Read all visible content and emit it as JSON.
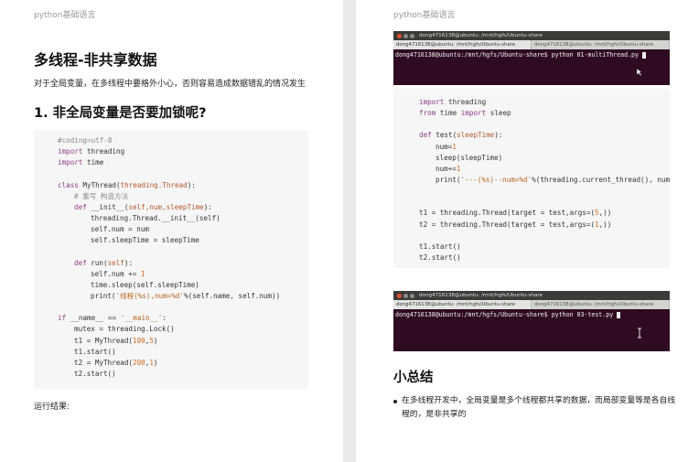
{
  "left_page": {
    "header": "python基础语言",
    "title": "多线程-非共享数据",
    "intro": "对于全局变量，在多线程中要格外小心，否则容易造成数据错乱的情况发生",
    "section_title": "1. 非全局变量是否要加锁呢?",
    "code": [
      {
        "i": 0,
        "s": [
          {
            "t": "#coding=utf-8",
            "c": "cm"
          }
        ]
      },
      {
        "i": 0,
        "s": [
          {
            "t": "import",
            "c": "kw"
          },
          {
            "t": " threading"
          }
        ]
      },
      {
        "i": 0,
        "s": [
          {
            "t": "import",
            "c": "kw"
          },
          {
            "t": " time"
          }
        ]
      },
      {
        "i": 0,
        "s": []
      },
      {
        "i": 0,
        "s": [
          {
            "t": "class",
            "c": "kw"
          },
          {
            "t": " MyThread("
          },
          {
            "t": "threading.Thread",
            "c": "pa"
          },
          {
            "t": "):"
          }
        ]
      },
      {
        "i": 1,
        "s": [
          {
            "t": "# 重写 构造方法",
            "c": "cm"
          }
        ]
      },
      {
        "i": 1,
        "s": [
          {
            "t": "def",
            "c": "kw"
          },
          {
            "t": " __init__("
          },
          {
            "t": "self,num,sleepTime",
            "c": "pa"
          },
          {
            "t": "):"
          }
        ]
      },
      {
        "i": 2,
        "s": [
          {
            "t": "threading.Thread.__init__(self)"
          }
        ]
      },
      {
        "i": 2,
        "s": [
          {
            "t": "self.num = num"
          }
        ]
      },
      {
        "i": 2,
        "s": [
          {
            "t": "self.sleepTime = sleepTime"
          }
        ]
      },
      {
        "i": 0,
        "s": []
      },
      {
        "i": 1,
        "s": [
          {
            "t": "def",
            "c": "kw"
          },
          {
            "t": " run("
          },
          {
            "t": "self",
            "c": "pa"
          },
          {
            "t": "):"
          }
        ]
      },
      {
        "i": 2,
        "s": [
          {
            "t": "self.num += "
          },
          {
            "t": "1",
            "c": "nm"
          }
        ]
      },
      {
        "i": 2,
        "s": [
          {
            "t": "time.sleep(self.sleepTime)"
          }
        ]
      },
      {
        "i": 2,
        "s": [
          {
            "t": "print("
          },
          {
            "t": "'线程(%s),num=%d'",
            "c": "st"
          },
          {
            "t": "%(self.name, self.num))"
          }
        ]
      },
      {
        "i": 0,
        "s": []
      },
      {
        "i": 0,
        "s": [
          {
            "t": "if",
            "c": "kw"
          },
          {
            "t": " __name__ == "
          },
          {
            "t": "'__main__'",
            "c": "st"
          },
          {
            "t": ":"
          }
        ]
      },
      {
        "i": 1,
        "s": [
          {
            "t": "mutex = threading.Lock()"
          }
        ]
      },
      {
        "i": 1,
        "s": [
          {
            "t": "t1 = MyThread("
          },
          {
            "t": "100",
            "c": "nm"
          },
          {
            "t": ","
          },
          {
            "t": "5",
            "c": "nm"
          },
          {
            "t": ")"
          }
        ]
      },
      {
        "i": 1,
        "s": [
          {
            "t": "t1.start()"
          }
        ]
      },
      {
        "i": 1,
        "s": [
          {
            "t": "t2 = MyThread("
          },
          {
            "t": "200",
            "c": "nm"
          },
          {
            "t": ","
          },
          {
            "t": "1",
            "c": "nm"
          },
          {
            "t": ")"
          }
        ]
      },
      {
        "i": 1,
        "s": [
          {
            "t": "t2.start()"
          }
        ]
      }
    ],
    "result_label": "运行结果:"
  },
  "right_page": {
    "header": "python基础语言",
    "terminal_1": {
      "title": "dong4716138@ubuntu: /mnt/hgfs/Ubuntu-share",
      "tabs": [
        "dong4716138@ubuntu: /mnt/hgfs/Ubuntu-share",
        "dong4716138@ubuntu: /mnt/hgfs/Ubuntu-share"
      ],
      "command": "dong4716138@ubuntu:/mnt/hgfs/Ubuntu-share$ python 01-multiThread.py"
    },
    "code": [
      {
        "i": 0,
        "s": [
          {
            "t": "import",
            "c": "kw"
          },
          {
            "t": " threading"
          }
        ]
      },
      {
        "i": 0,
        "s": [
          {
            "t": "from",
            "c": "kw"
          },
          {
            "t": " time "
          },
          {
            "t": "import",
            "c": "kw"
          },
          {
            "t": " sleep"
          }
        ]
      },
      {
        "i": 0,
        "s": []
      },
      {
        "i": 0,
        "s": [
          {
            "t": "def",
            "c": "kw"
          },
          {
            "t": " test("
          },
          {
            "t": "sleepTime",
            "c": "pa"
          },
          {
            "t": "):"
          }
        ]
      },
      {
        "i": 1,
        "s": [
          {
            "t": "num="
          },
          {
            "t": "1",
            "c": "nm"
          }
        ]
      },
      {
        "i": 1,
        "s": [
          {
            "t": "sleep(sleepTime)"
          }
        ]
      },
      {
        "i": 1,
        "s": [
          {
            "t": "num+="
          },
          {
            "t": "1",
            "c": "nm"
          }
        ]
      },
      {
        "i": 1,
        "s": [
          {
            "t": "print("
          },
          {
            "t": "'---(%s)--num=%d'",
            "c": "st"
          },
          {
            "t": "%(threading.current_thread(), num"
          }
        ]
      },
      {
        "i": 0,
        "s": []
      },
      {
        "i": 0,
        "s": []
      },
      {
        "i": 0,
        "s": [
          {
            "t": "t1 = threading.Thread(target = test,args=("
          },
          {
            "t": "5",
            "c": "nm"
          },
          {
            "t": ",))"
          }
        ]
      },
      {
        "i": 0,
        "s": [
          {
            "t": "t2 = threading.Thread(target = test,args=("
          },
          {
            "t": "1",
            "c": "nm"
          },
          {
            "t": ",))"
          }
        ]
      },
      {
        "i": 0,
        "s": []
      },
      {
        "i": 0,
        "s": [
          {
            "t": "t1.start()"
          }
        ]
      },
      {
        "i": 0,
        "s": [
          {
            "t": "t2.start()"
          }
        ]
      }
    ],
    "terminal_2": {
      "title": "dong4716138@ubuntu: /mnt/hgfs/Ubuntu-share",
      "tabs": [
        "dong4716138@ubuntu: /mnt/hgfs/Ubuntu-share",
        "dong4716138@ubuntu: /mnt/hgfs/Ubuntu-share"
      ],
      "command": "dong4716138@ubuntu:/mnt/hgfs/Ubuntu-share$ python 03-test.py"
    },
    "summary_title": "小总结",
    "summary_items": [
      "在多线程开发中，全局变量是多个线程都共享的数据，而局部变量等是各自线程的，是非共享的"
    ]
  }
}
